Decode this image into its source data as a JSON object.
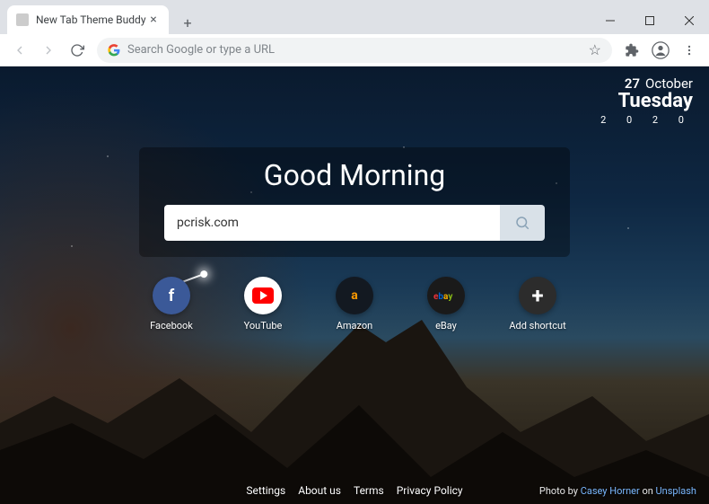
{
  "window": {
    "tab_title": "New Tab Theme Buddy"
  },
  "toolbar": {
    "omnibox_placeholder": "Search Google or type a URL"
  },
  "date": {
    "day_number": "27",
    "month": "October",
    "weekday": "Tuesday",
    "year": "2 0 2 0"
  },
  "page": {
    "greeting": "Good Morning",
    "search_value": "pcrisk.com"
  },
  "shortcuts": [
    {
      "id": "facebook",
      "label": "Facebook"
    },
    {
      "id": "youtube",
      "label": "YouTube"
    },
    {
      "id": "amazon",
      "label": "Amazon"
    },
    {
      "id": "ebay",
      "label": "eBay"
    },
    {
      "id": "add",
      "label": "Add shortcut"
    }
  ],
  "footer": {
    "links": [
      "Settings",
      "About us",
      "Terms",
      "Privacy Policy"
    ],
    "credit_prefix": "Photo by",
    "credit_author": "Casey Horner",
    "credit_on": "on",
    "credit_source": "Unsplash"
  }
}
